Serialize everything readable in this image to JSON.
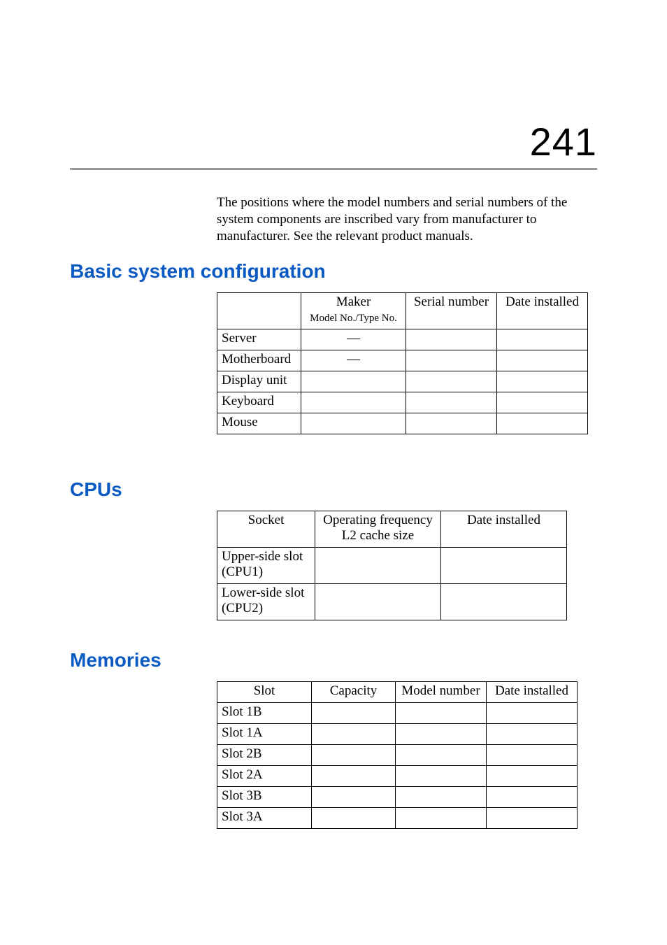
{
  "pageNumber": "241",
  "intro": "The positions where the model numbers and serial numbers of the system components are inscribed vary from manufacturer to manufacturer.  See the relevant product manuals.",
  "sections": {
    "basic": {
      "title": "Basic system configuration",
      "headers": {
        "h1_line1": "Maker",
        "h1_line2": "Model No./Type No.",
        "h2": "Serial number",
        "h3": "Date installed"
      },
      "rows": [
        {
          "label": "Server",
          "maker": "—",
          "serial": "",
          "date": ""
        },
        {
          "label": "Motherboard",
          "maker": "—",
          "serial": "",
          "date": ""
        },
        {
          "label": "Display unit",
          "maker": "",
          "serial": "",
          "date": ""
        },
        {
          "label": "Keyboard",
          "maker": "",
          "serial": "",
          "date": ""
        },
        {
          "label": "Mouse",
          "maker": "",
          "serial": "",
          "date": ""
        }
      ]
    },
    "cpus": {
      "title": "CPUs",
      "headers": {
        "h0": "Socket",
        "h1_line1": "Operating frequency",
        "h1_line2": "L2 cache size",
        "h2": "Date installed"
      },
      "rows": [
        {
          "label_line1": "Upper-side slot",
          "label_line2": "(CPU1)",
          "freq": "",
          "date": ""
        },
        {
          "label_line1": "Lower-side slot",
          "label_line2": "(CPU2)",
          "freq": "",
          "date": ""
        }
      ]
    },
    "memories": {
      "title": "Memories",
      "headers": {
        "h0": "Slot",
        "h1": "Capacity",
        "h2": "Model number",
        "h3": "Date installed"
      },
      "rows": [
        {
          "label": "Slot 1B",
          "capacity": "",
          "model": "",
          "date": ""
        },
        {
          "label": "Slot 1A",
          "capacity": "",
          "model": "",
          "date": ""
        },
        {
          "label": "Slot 2B",
          "capacity": "",
          "model": "",
          "date": ""
        },
        {
          "label": "Slot 2A",
          "capacity": "",
          "model": "",
          "date": ""
        },
        {
          "label": "Slot 3B",
          "capacity": "",
          "model": "",
          "date": ""
        },
        {
          "label": "Slot 3A",
          "capacity": "",
          "model": "",
          "date": ""
        }
      ]
    }
  }
}
